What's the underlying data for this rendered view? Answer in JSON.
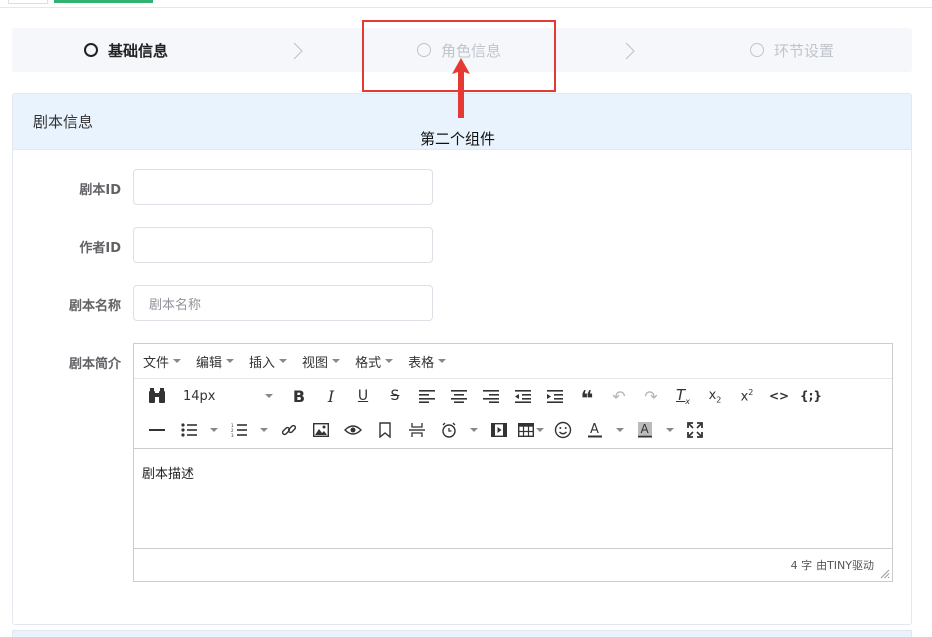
{
  "steps": [
    {
      "label": "基础信息",
      "state": "active"
    },
    {
      "label": "角色信息",
      "state": "inactive"
    },
    {
      "label": "环节设置",
      "state": "inactive"
    }
  ],
  "annotation": {
    "text": "第二个组件",
    "color": "#e53935"
  },
  "card": {
    "title": "剧本信息"
  },
  "form": {
    "script_id_label": "剧本ID",
    "script_id_value": "",
    "author_id_label": "作者ID",
    "author_id_value": "",
    "script_name_label": "剧本名称",
    "script_name_placeholder": "剧本名称",
    "script_intro_label": "剧本简介"
  },
  "editor": {
    "menus": [
      "文件",
      "编辑",
      "插入",
      "视图",
      "格式",
      "表格"
    ],
    "font_size": "14px",
    "content": "剧本描述",
    "word_count": "4 字",
    "powered_by": "由TINY驱动",
    "icons_row1": [
      "binoculars-icon",
      "bold-icon",
      "italic-icon",
      "underline-icon",
      "strikethrough-icon",
      "align-left-icon",
      "align-center-icon",
      "align-right-icon",
      "outdent-icon",
      "indent-icon",
      "blockquote-icon",
      "undo-icon",
      "redo-icon",
      "clear-format-icon",
      "subscript-icon",
      "superscript-icon",
      "code-icon",
      "code-sample-icon"
    ],
    "icons_row2": [
      "horizontal-rule-icon",
      "bullet-list-icon",
      "numbered-list-icon",
      "link-icon",
      "image-icon",
      "preview-icon",
      "bookmark-icon",
      "page-break-icon",
      "clock-icon",
      "media-icon",
      "table-icon",
      "emoticon-icon",
      "text-color-icon",
      "background-color-icon",
      "fullscreen-icon"
    ]
  },
  "colors": {
    "accent": "#2fb36f",
    "header_bg": "#e8f3fd",
    "annotation": "#e53935"
  }
}
